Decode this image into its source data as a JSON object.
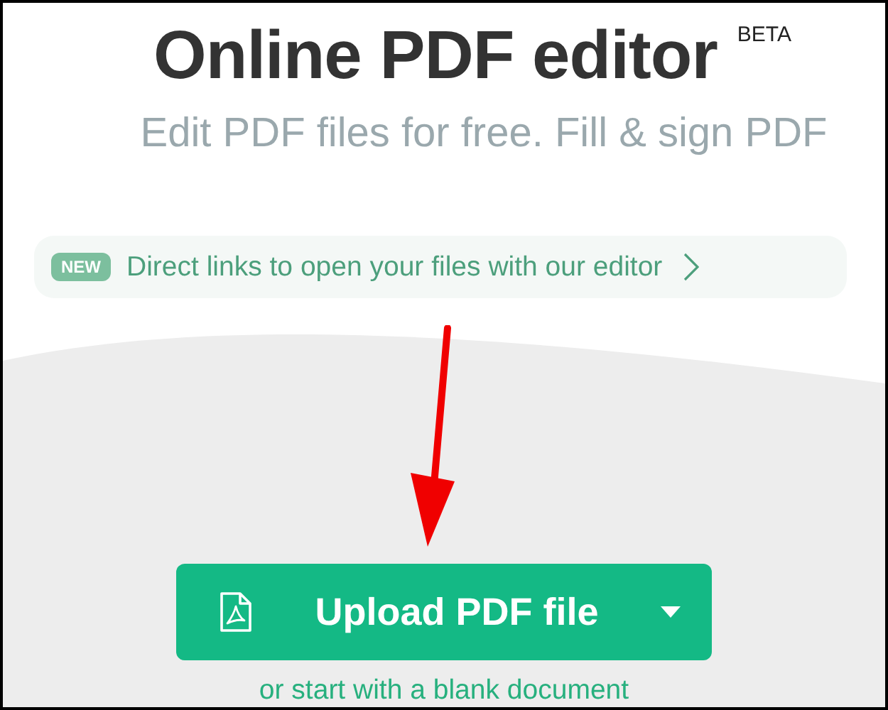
{
  "header": {
    "title": "Online PDF editor",
    "badge": "BETA",
    "subtitle": "Edit PDF files for free. Fill & sign PDF"
  },
  "announcement": {
    "tag": "NEW",
    "text": "Direct links to open your files with our editor"
  },
  "upload_button": {
    "label": "Upload PDF file"
  },
  "secondary_link": "or start with a blank document",
  "annotation": {
    "kind": "arrow"
  }
}
